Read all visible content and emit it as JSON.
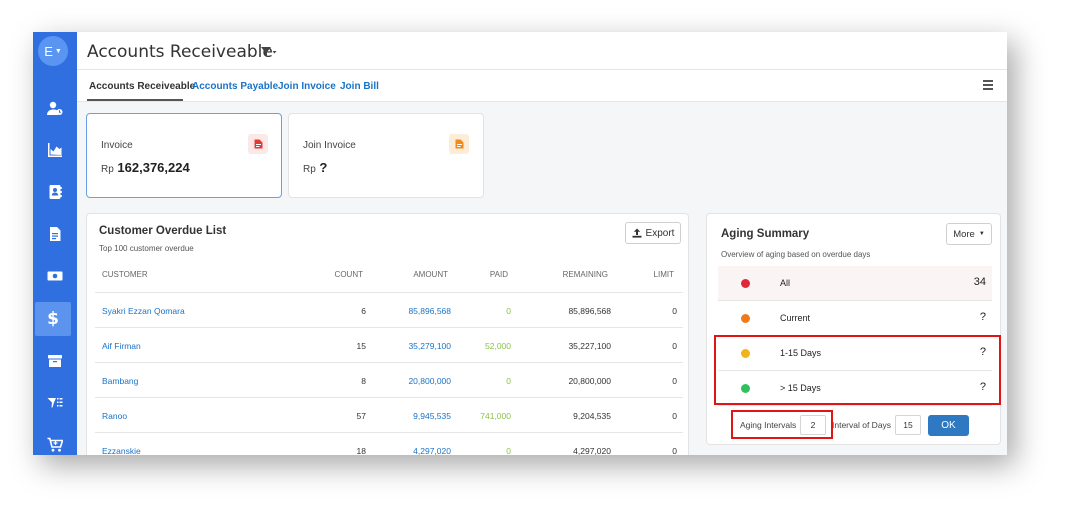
{
  "user": {
    "initial": "E"
  },
  "header": {
    "title": "Accounts Receiveable"
  },
  "tabs": [
    {
      "label": "Accounts Receiveable"
    },
    {
      "label": "Accounts Payable"
    },
    {
      "label": "Join Invoice"
    },
    {
      "label": "Join Bill"
    }
  ],
  "cards": {
    "invoice": {
      "label": "Invoice",
      "currency": "Rp",
      "value": "162,376,224"
    },
    "join_invoice": {
      "label": "Join Invoice",
      "currency": "Rp",
      "value": "?"
    }
  },
  "overdue": {
    "title": "Customer Overdue List",
    "subtitle": "Top 100 customer overdue",
    "export_label": "Export",
    "columns": [
      "CUSTOMER",
      "COUNT",
      "AMOUNT",
      "PAID",
      "REMAINING",
      "LIMIT"
    ],
    "rows": [
      {
        "customer": "Syakri Ezzan Qomara",
        "count": "6",
        "amount": "85,896,568",
        "paid": "0",
        "remaining": "85,896,568",
        "limit": "0"
      },
      {
        "customer": "Aif Firman",
        "count": "15",
        "amount": "35,279,100",
        "paid": "52,000",
        "remaining": "35,227,100",
        "limit": "0"
      },
      {
        "customer": "Bambang",
        "count": "8",
        "amount": "20,800,000",
        "paid": "0",
        "remaining": "20,800,000",
        "limit": "0"
      },
      {
        "customer": "Ranoo",
        "count": "57",
        "amount": "9,945,535",
        "paid": "741,000",
        "remaining": "9,204,535",
        "limit": "0"
      },
      {
        "customer": "Ezzanskie",
        "count": "18",
        "amount": "4,297,020",
        "paid": "0",
        "remaining": "4,297,020",
        "limit": "0"
      }
    ]
  },
  "aging": {
    "title": "Aging Summary",
    "subtitle": "Overview of aging based on overdue days",
    "more_label": "More",
    "rows": [
      {
        "label": "All",
        "value": "34",
        "color": "#e0273a"
      },
      {
        "label": "Current",
        "value": "?",
        "color": "#f07a1a"
      },
      {
        "label": "1-15 Days",
        "value": "?",
        "color": "#f0b41a"
      },
      {
        "label": "> 15 Days",
        "value": "?",
        "color": "#2ec25e"
      }
    ],
    "intervals_label": "Aging Intervals",
    "intervals_value": "2",
    "days_label": "Interval of Days",
    "days_value": "15",
    "ok_label": "OK"
  },
  "colors": {
    "sidebar": "#2f6fe0",
    "link": "#1a73c7",
    "highlight": "#e01616"
  }
}
